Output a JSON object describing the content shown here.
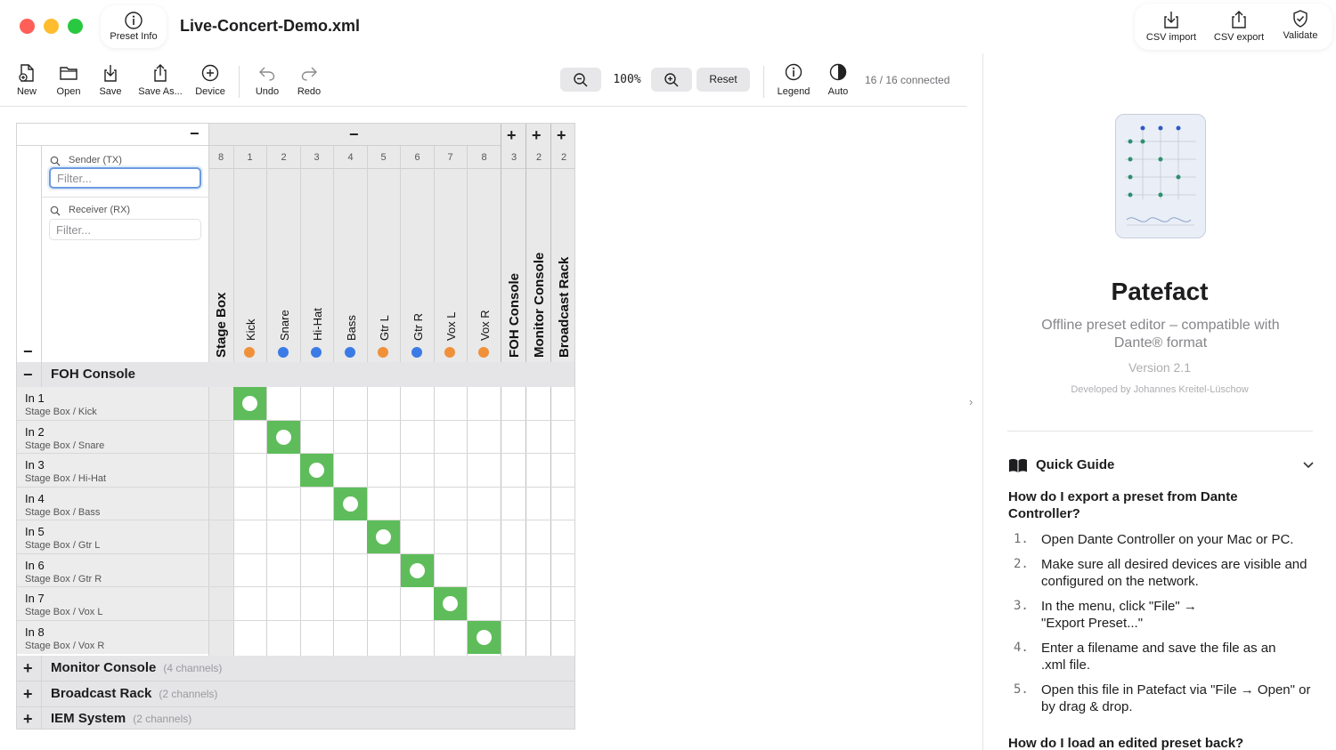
{
  "window": {
    "title": "Live-Concert-Demo.xml",
    "preset_info_label": "Preset Info",
    "top_actions": [
      {
        "label": "CSV import",
        "icon": "download-icon"
      },
      {
        "label": "CSV export",
        "icon": "share-icon"
      },
      {
        "label": "Validate",
        "icon": "shield-check-icon"
      }
    ]
  },
  "toolbar": {
    "items": [
      {
        "label": "New",
        "icon": "new-document-icon"
      },
      {
        "label": "Open",
        "icon": "folder-icon"
      },
      {
        "label": "Save",
        "icon": "save-icon"
      },
      {
        "label": "Save As...",
        "icon": "share-icon"
      },
      {
        "label": "Device",
        "icon": "plus-circle-icon"
      },
      {
        "label": "Undo",
        "icon": "undo-icon"
      },
      {
        "label": "Redo",
        "icon": "redo-icon"
      }
    ],
    "zoom_level": "100%",
    "reset_label": "Reset",
    "legend_label": "Legend",
    "auto_label": "Auto",
    "connected_status": "16 / 16 connected"
  },
  "filters": {
    "sender_label": "Sender (TX)",
    "sender_placeholder": "Filter...",
    "receiver_label": "Receiver (RX)",
    "receiver_placeholder": "Filter..."
  },
  "columns": {
    "expanded_group": {
      "name": "Stage Box",
      "count": "8"
    },
    "channels": [
      {
        "num": "1",
        "name": "Kick",
        "color": "#f0913a"
      },
      {
        "num": "2",
        "name": "Snare",
        "color": "#3b7be6"
      },
      {
        "num": "3",
        "name": "Hi-Hat",
        "color": "#3b7be6"
      },
      {
        "num": "4",
        "name": "Bass",
        "color": "#3b7be6"
      },
      {
        "num": "5",
        "name": "Gtr L",
        "color": "#f0913a"
      },
      {
        "num": "6",
        "name": "Gtr R",
        "color": "#3b7be6"
      },
      {
        "num": "7",
        "name": "Vox L",
        "color": "#f0913a"
      },
      {
        "num": "8",
        "name": "Vox R",
        "color": "#f0913a"
      }
    ],
    "collapsed_groups": [
      {
        "name": "FOH Console",
        "count": "3"
      },
      {
        "name": "Monitor Console",
        "count": "2"
      },
      {
        "name": "Broadcast Rack",
        "count": "2"
      }
    ]
  },
  "rows": {
    "expanded_group": "FOH Console",
    "channels": [
      {
        "name": "In 1",
        "source": "Stage Box / Kick"
      },
      {
        "name": "In 2",
        "source": "Stage Box / Snare"
      },
      {
        "name": "In 3",
        "source": "Stage Box / Hi-Hat"
      },
      {
        "name": "In 4",
        "source": "Stage Box / Bass"
      },
      {
        "name": "In 5",
        "source": "Stage Box / Gtr L"
      },
      {
        "name": "In 6",
        "source": "Stage Box / Gtr R"
      },
      {
        "name": "In 7",
        "source": "Stage Box / Vox L"
      },
      {
        "name": "In 8",
        "source": "Stage Box / Vox R"
      }
    ],
    "connections": [
      1,
      2,
      3,
      4,
      5,
      6,
      7,
      8
    ],
    "collapsed_groups": [
      {
        "name": "Monitor Console",
        "channels": "(4 channels)"
      },
      {
        "name": "Broadcast Rack",
        "channels": "(2 channels)"
      },
      {
        "name": "IEM System",
        "channels": "(2 channels)"
      }
    ]
  },
  "about": {
    "app_name": "Patefact",
    "subtitle": "Offline preset editor – compatible with Dante® format",
    "version": "Version 2.1",
    "developer": "Developed by Johannes Kreitel-Lüschow"
  },
  "quick_guide": {
    "title": "Quick Guide",
    "question1": "How do I export a preset from Dante Controller?",
    "steps": [
      {
        "num": "1.",
        "text": "Open Dante Controller on your Mac or PC."
      },
      {
        "num": "2.",
        "text": "Make sure all desired devices are visible and configured on the network."
      },
      {
        "num": "3.",
        "text": "In the menu, click \"File\" → \"Export Preset...\""
      },
      {
        "num": "4.",
        "text": "Enter a filename and save the file as an .xml file."
      },
      {
        "num": "5.",
        "text": "Open this file in Patefact via \"File → Open\" or by drag & drop."
      }
    ],
    "question2": "How do I load an edited preset back?"
  },
  "colors": {
    "connection": "#5ebd5a",
    "tx_dot_orange": "#f0913a",
    "tx_dot_blue": "#3b7be6",
    "accent_focus": "#6b9be0"
  }
}
